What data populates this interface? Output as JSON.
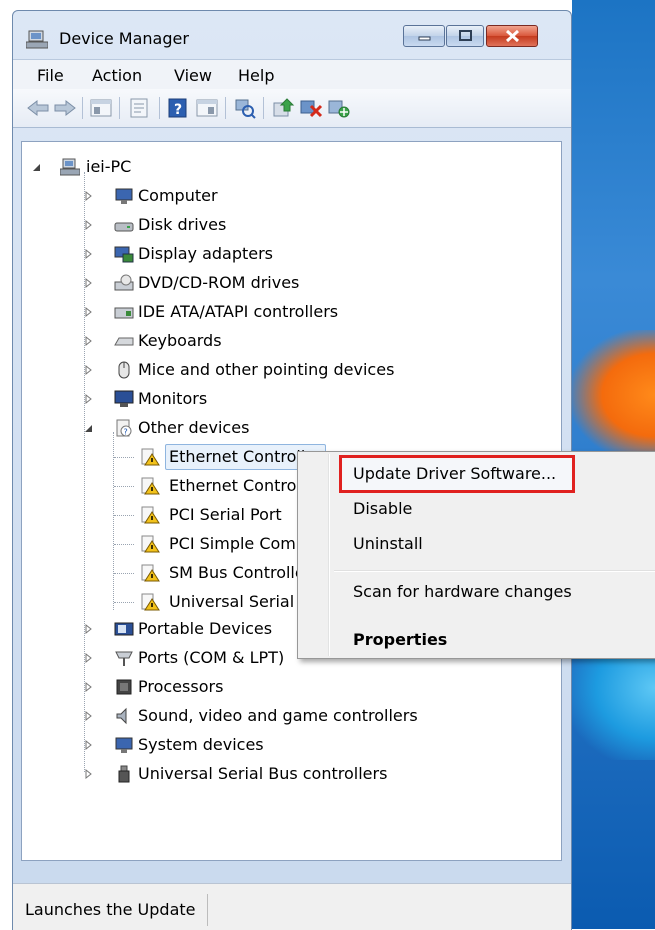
{
  "window": {
    "title": "Device Manager"
  },
  "menu": {
    "file": "File",
    "action": "Action",
    "view": "View",
    "help": "Help"
  },
  "tree": {
    "root": "iei-PC",
    "categories": {
      "computer": "Computer",
      "disk": "Disk drives",
      "display": "Display adapters",
      "dvd": "DVD/CD-ROM drives",
      "ide": "IDE ATA/ATAPI controllers",
      "keyboards": "Keyboards",
      "mice": "Mice and other pointing devices",
      "monitors": "Monitors",
      "other": "Other devices",
      "portable": "Portable Devices",
      "ports": "Ports (COM & LPT)",
      "processors": "Processors",
      "sound": "Sound, video and game controllers",
      "system": "System devices",
      "usb": "Universal Serial Bus controllers"
    },
    "other_devices": [
      "Ethernet Controller",
      "Ethernet Control",
      "PCI Serial Port",
      "PCI Simple Comr",
      "SM Bus Controlle",
      "Universal Serial B"
    ]
  },
  "context_menu": {
    "update": "Update Driver Software...",
    "disable": "Disable",
    "uninstall": "Uninstall",
    "scan": "Scan for hardware changes",
    "properties": "Properties"
  },
  "status": {
    "text": "Launches the Update"
  },
  "colors": {
    "highlight_box": "#e0211f",
    "warning_icon": "#f2c21b"
  }
}
